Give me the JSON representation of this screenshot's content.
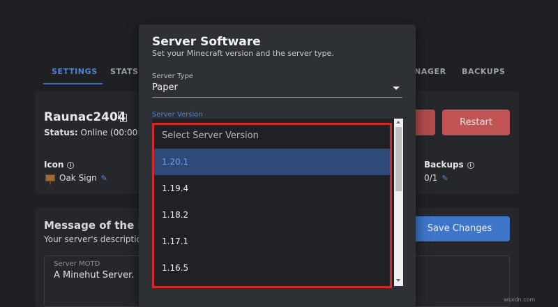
{
  "tabs": [
    {
      "label": "SETTINGS",
      "active": true
    },
    {
      "label": "STATS"
    },
    {
      "label": "NAGER"
    },
    {
      "label": "BACKUPS"
    }
  ],
  "server": {
    "name": "Raunac2404",
    "status_label": "Status:",
    "status_value": "Online (00:00:0"
  },
  "icon_section": {
    "label": "Icon",
    "value": "Oak Sign"
  },
  "buttons": {
    "restart": "Restart",
    "save": "Save Changes"
  },
  "backups": {
    "label": "Backups",
    "count": "0/1"
  },
  "motd": {
    "title": "Message of the D",
    "subtitle": "Your server's description",
    "field_label": "Server MOTD",
    "field_value": "A Minehut Server."
  },
  "dialog": {
    "title": "Server Software",
    "subtitle": "Set your Minecraft version and the server type.",
    "server_type_label": "Server Type",
    "server_type_value": "Paper",
    "server_version_label": "Server Version"
  },
  "version_dropdown": {
    "placeholder": "Select Server Version",
    "options": [
      "1.20.1",
      "1.19.4",
      "1.18.2",
      "1.17.1",
      "1.16.5"
    ],
    "selected": "1.20.1"
  },
  "watermark": "wsxdn.com",
  "colors": {
    "accent": "#4f83d6",
    "danger": "#c05454",
    "highlight": "#d42a2a",
    "selected_bg": "#2f4a78"
  }
}
